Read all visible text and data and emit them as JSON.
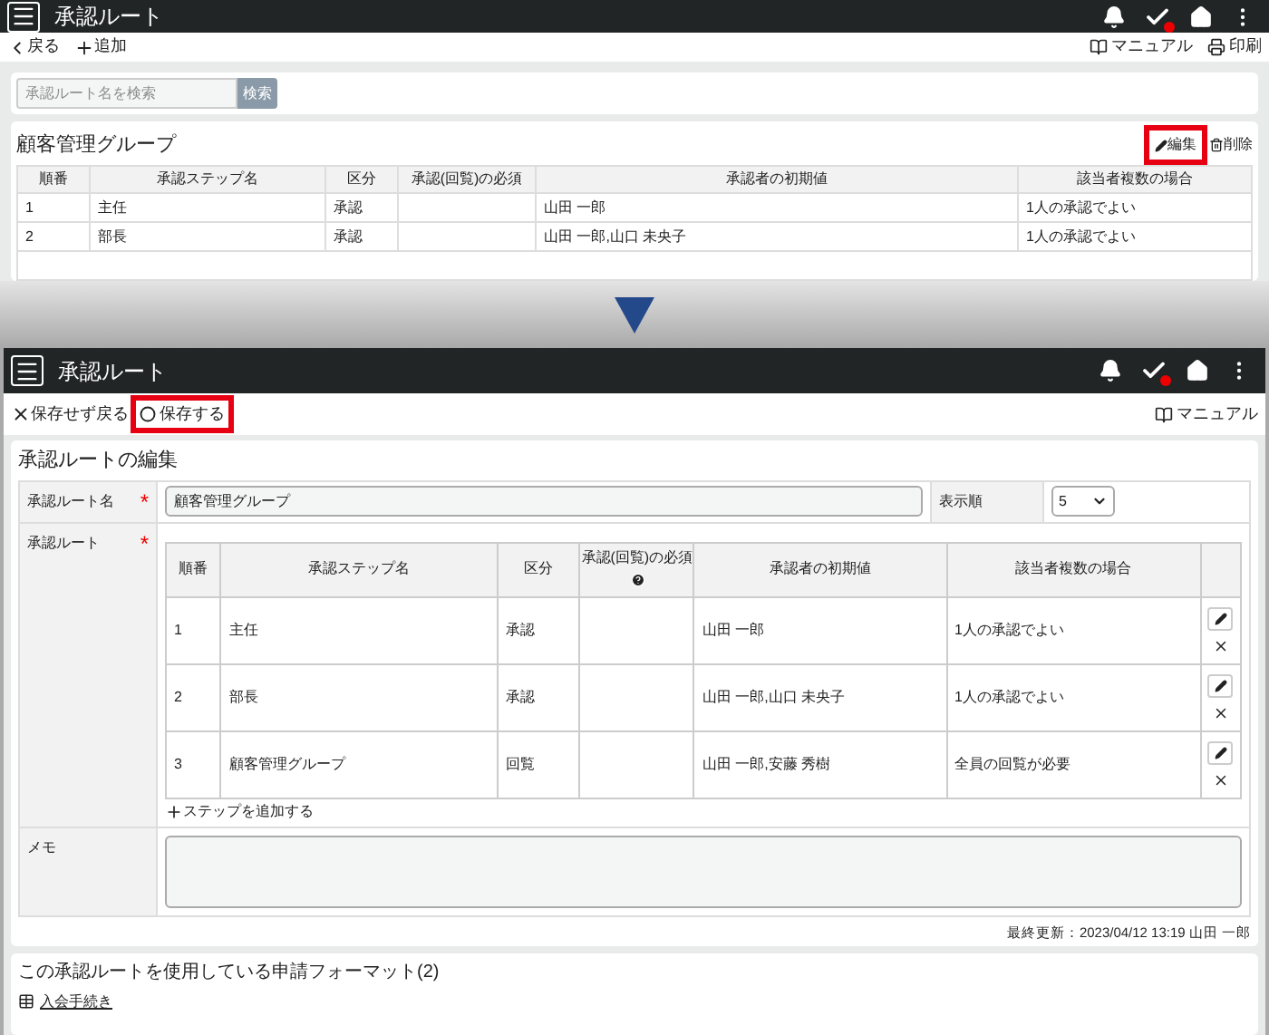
{
  "top_screen": {
    "header": {
      "title": "承認ルート"
    },
    "toolbar": {
      "back": "戻る",
      "add": "追加",
      "manual": "マニュアル",
      "print": "印刷"
    },
    "search": {
      "placeholder": "承認ルート名を検索",
      "button": "検索"
    },
    "group": {
      "title": "顧客管理グループ",
      "edit": {
        "label": "編集",
        "highlighted": true
      },
      "delete": "削除",
      "columns": [
        "順番",
        "承認ステップ名",
        "区分",
        "承認(回覧)の必須",
        "承認者の初期値",
        "該当者複数の場合"
      ],
      "rows": [
        [
          "1",
          "主任",
          "承認",
          "",
          "山田 一郎",
          "1人の承認でよい"
        ],
        [
          "2",
          "部長",
          "承認",
          "",
          "山田 一郎,山口 未央子",
          "1人の承認でよい"
        ]
      ]
    }
  },
  "edit_screen": {
    "header": {
      "title": "承認ルート"
    },
    "toolbar": {
      "cancel": "保存せず戻る",
      "save": {
        "label": "保存する",
        "highlighted": true
      },
      "manual": "マニュアル"
    },
    "form": {
      "title": "承認ルートの編集",
      "name_field": {
        "label": "承認ルート名",
        "required_mark": "*",
        "value": "顧客管理グループ"
      },
      "order_field": {
        "label": "表示順",
        "value": "5"
      },
      "route": {
        "label": "承認ルート",
        "required_mark": "*",
        "columns": [
          {
            "label": "順番",
            "help": false
          },
          {
            "label": "承認ステップ名",
            "help": false
          },
          {
            "label": "区分",
            "help": false
          },
          {
            "label": "承認(回覧)の必須",
            "help": true
          },
          {
            "label": "承認者の初期値",
            "help": false
          },
          {
            "label": "該当者複数の場合",
            "help": false
          }
        ],
        "rows": [
          [
            "1",
            "主任",
            "承認",
            "",
            "山田 一郎",
            "1人の承認でよい"
          ],
          [
            "2",
            "部長",
            "承認",
            "",
            "山田 一郎,山口 未央子",
            "1人の承認でよい"
          ],
          [
            "3",
            "顧客管理グループ",
            "回覧",
            "",
            "山田 一郎,安藤 秀樹",
            "全員の回覧が必要"
          ]
        ],
        "add_step": "ステップを追加する"
      },
      "memo_label": "メモ",
      "last_updated": "最終更新：2023/04/12 13:19 山田 一郎"
    },
    "formats": {
      "title": "この承認ルートを使用している申請フォーマット(2)",
      "items": [
        "入会手続き"
      ]
    }
  }
}
